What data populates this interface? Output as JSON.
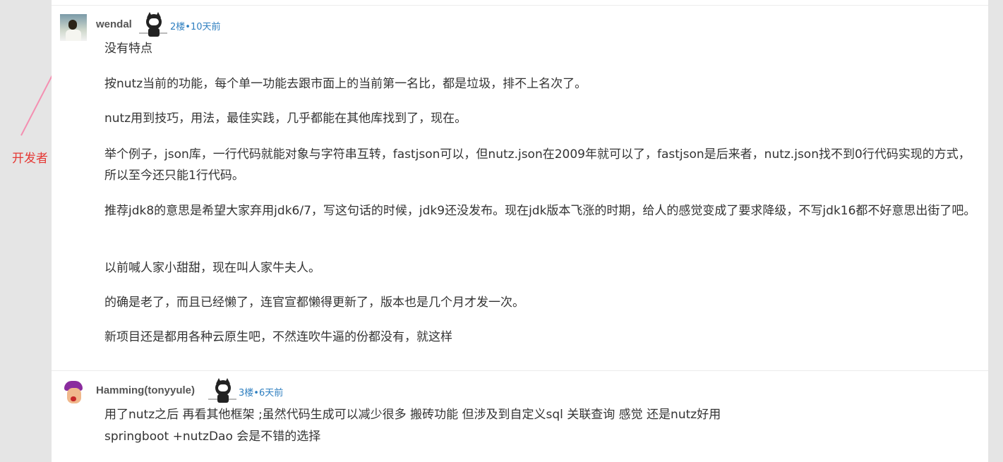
{
  "annotation": {
    "label": "开发者"
  },
  "comments": [
    {
      "username": "wendal",
      "meta": "2楼•10天前",
      "paragraphs": [
        "没有特点",
        "按nutz当前的功能，每个单一功能去跟市面上的当前第一名比，都是垃圾，排不上名次了。",
        "nutz用到技巧，用法，最佳实践，几乎都能在其他库找到了，现在。",
        "举个例子，json库，一行代码就能对象与字符串互转，fastjson可以，但nutz.json在2009年就可以了，fastjson是后来者，nutz.json找不到0行代码实现的方式，所以至今还只能1行代码。",
        "推荐jdk8的意思是希望大家弃用jdk6/7，写这句话的时候，jdk9还没发布。现在jdk版本飞涨的时期，给人的感觉变成了要求降级，不写jdk16都不好意思出街了吧。",
        "以前喊人家小甜甜，现在叫人家牛夫人。",
        "的确是老了，而且已经懒了，连官宣都懒得更新了，版本也是几个月才发一次。",
        "新项目还是都用各种云原生吧，不然连吹牛逼的份都没有，就这样"
      ]
    },
    {
      "username": "Hamming(tonyyule)",
      "meta": "3楼•6天前",
      "lines": [
        "用了nutz之后 再看其他框架 ;虽然代码生成可以减少很多 搬砖功能 但涉及到自定义sql 关联查询 感觉 还是nutz好用",
        "springboot +nutzDao 会是不错的选择"
      ]
    }
  ],
  "colors": {
    "annotation": "#e53935",
    "arrow": "#f48fb1",
    "meta": "#2f7fc0"
  }
}
